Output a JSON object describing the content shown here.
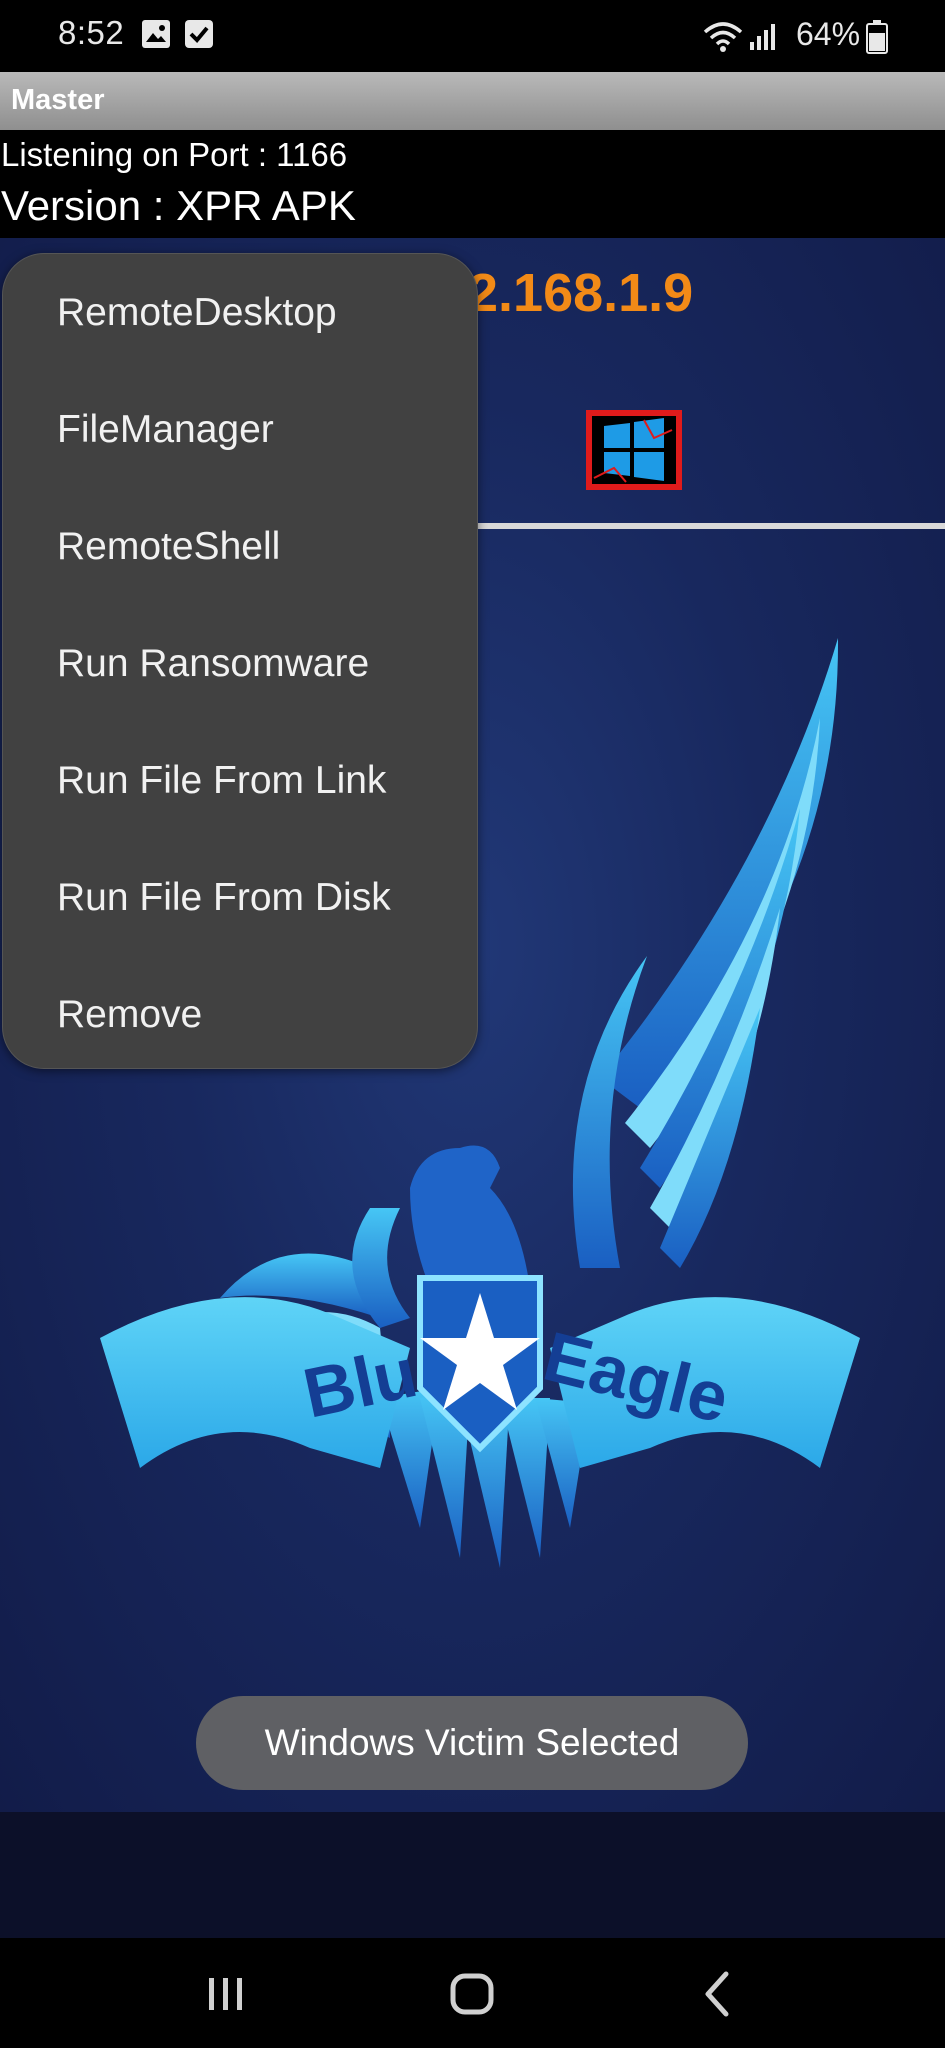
{
  "status_bar": {
    "time": "8:52",
    "battery_percent": "64%",
    "icons": [
      "gallery-icon",
      "checkbox-icon",
      "wifi-icon",
      "signal-icon",
      "battery-icon"
    ]
  },
  "app_title": "Master",
  "header": {
    "port_text": "Listening on Port : 1166",
    "version_text": "Version : XPR APK"
  },
  "main": {
    "ip_text": "2.168.1.9",
    "logo_text_left": "Blue",
    "logo_text_right": "Eagle"
  },
  "context_menu": {
    "items": [
      "RemoteDesktop",
      "FileManager",
      "RemoteShell",
      "Run Ransomware",
      "Run File From Link",
      "Run File From Disk",
      "Remove"
    ]
  },
  "toast": "Windows Victim Selected",
  "colors": {
    "ip_orange": "#f28a17",
    "menu_bg": "#414141",
    "background_blue": "#18285e",
    "eagle_blue": "#2ba8e8"
  },
  "nav_bar": {
    "icons": [
      "recent-apps-icon",
      "home-icon",
      "back-icon"
    ]
  }
}
